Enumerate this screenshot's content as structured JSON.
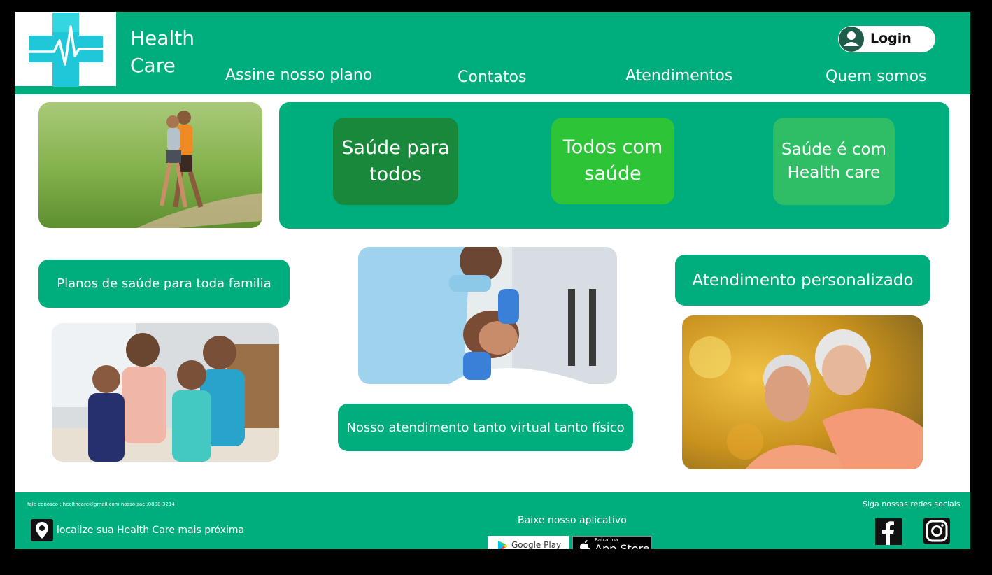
{
  "header": {
    "brand_line1": "Health",
    "brand_line2": "Care",
    "login_label": "Login",
    "nav": [
      "Assine nosso plano",
      "Contatos",
      "Atendimentos",
      "Quem somos"
    ]
  },
  "banner": {
    "slogans": [
      {
        "line1": "Saúde para",
        "line2": "todos",
        "color": "#18883a"
      },
      {
        "line1": "Todos com",
        "line2": "saúde",
        "color": "#2ec438"
      },
      {
        "line1": "Saúde é com",
        "line2": "Health care",
        "color": "#2fbd66"
      }
    ]
  },
  "main": {
    "pill_family": "Planos de saúde para toda familia",
    "pill_virtual": "Nosso atendimento tanto virtual tanto físico",
    "pill_personal": "Atendimento personalizado"
  },
  "footer": {
    "contact": "fale conosco : healthcare@gmail.com nosso sac :0800-3214",
    "locate": "localize sua Health Care mais próxima",
    "app_title": "Baixe nosso aplicativo",
    "google_play": "Google Play",
    "app_store_small": "Baixar na",
    "app_store_big": "App Store",
    "social_title": "Siga nossas redes sociais"
  },
  "icons": {
    "logo": "medical-cross-heartbeat-icon",
    "login": "user-icon",
    "map": "map-pin-icon",
    "facebook": "facebook-icon",
    "instagram": "instagram-icon",
    "google_play": "google-play-icon",
    "apple": "apple-icon"
  },
  "colors": {
    "brand_green": "#00ad7c",
    "logo_cyan": "#1ec8d8"
  }
}
